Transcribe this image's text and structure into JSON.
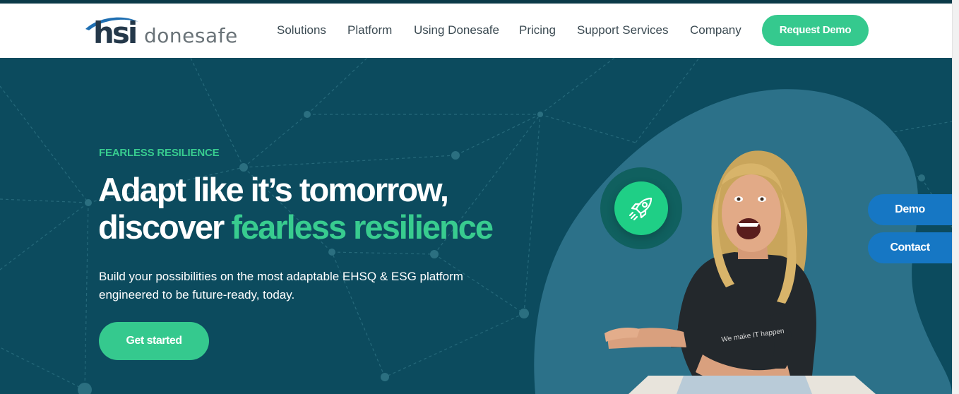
{
  "brand": {
    "logo_mark": "hsi",
    "logo_wordmark": "donesafe",
    "accent_green": "#35c98e",
    "dark_teal": "#0c4b5e",
    "side_blue": "#1677c4"
  },
  "nav": {
    "items": [
      {
        "label": "Solutions"
      },
      {
        "label": "Platform"
      },
      {
        "label": "Using Donesafe"
      },
      {
        "label": "Pricing"
      },
      {
        "label": "Support Services"
      },
      {
        "label": "Company"
      }
    ],
    "cta_label": "Request Demo"
  },
  "hero": {
    "eyebrow": "FEARLESS RESILIENCE",
    "headline_line1": "Adapt like it’s tomorrow,",
    "headline_line2_plain": "discover ",
    "headline_line2_highlight": "fearless resilience",
    "subcopy_line1": "Build your possibilities on the most adaptable EHSQ & ESG platform",
    "subcopy_line2": "engineered to be future-ready, today.",
    "cta_label": "Get started",
    "badge_icon": "rocket-icon",
    "shirt_text": "We make IT happen"
  },
  "side_tabs": [
    {
      "label": "Demo"
    },
    {
      "label": "Contact"
    }
  ]
}
